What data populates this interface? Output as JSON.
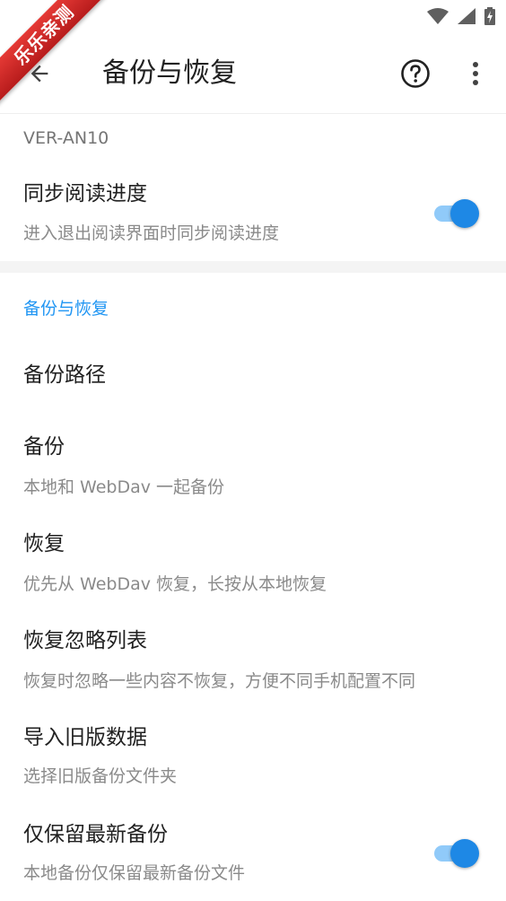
{
  "watermark": {
    "text": "乐乐亲测"
  },
  "toolbar": {
    "title": "备份与恢复"
  },
  "device": {
    "name": "VER-AN10"
  },
  "sync_reading": {
    "title": "同步阅读进度",
    "summary": "进入退出阅读界面时同步阅读进度",
    "enabled": true
  },
  "category": {
    "label": "备份与恢复"
  },
  "items": [
    {
      "title": "备份路径",
      "summary": ""
    },
    {
      "title": "备份",
      "summary": "本地和 WebDav 一起备份"
    },
    {
      "title": "恢复",
      "summary": "优先从 WebDav 恢复，长按从本地恢复"
    },
    {
      "title": "恢复忽略列表",
      "summary": "恢复时忽略一些内容不恢复，方便不同手机配置不同"
    },
    {
      "title": "导入旧版数据",
      "summary": "选择旧版备份文件夹"
    },
    {
      "title": "仅保留最新备份",
      "summary": "本地备份仅保留最新备份文件",
      "enabled": true
    }
  ],
  "colors": {
    "accent": "#2196f3",
    "switch_thumb": "#1e88e5",
    "switch_track": "#90caf9",
    "watermark": "#d32f2f"
  },
  "icons": {
    "back": "arrow-back-icon",
    "help": "help-circle-icon",
    "more": "more-vert-icon",
    "wifi": "wifi-icon",
    "signal": "signal-icon",
    "battery": "battery-charging-icon"
  }
}
